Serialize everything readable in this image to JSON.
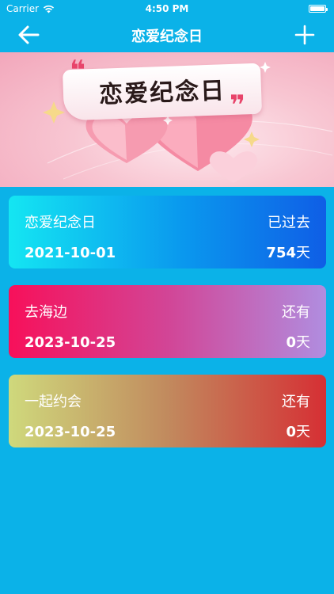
{
  "status_bar": {
    "carrier": "Carrier",
    "time": "4:50 PM"
  },
  "nav": {
    "title": "恋爱纪念日",
    "back_icon": "arrow-left-icon",
    "add_icon": "plus-icon"
  },
  "banner": {
    "title": "恋爱纪念日"
  },
  "events": [
    {
      "name": "恋爱纪念日",
      "status": "已过去",
      "date": "2021-10-01",
      "days": "754",
      "unit": "天"
    },
    {
      "name": "去海边",
      "status": "还有",
      "date": "2023-10-25",
      "days": "0",
      "unit": "天"
    },
    {
      "name": "一起约会",
      "status": "还有",
      "date": "2023-10-25",
      "days": "0",
      "unit": "天"
    }
  ],
  "colors": {
    "background": "#0bb2e8"
  }
}
